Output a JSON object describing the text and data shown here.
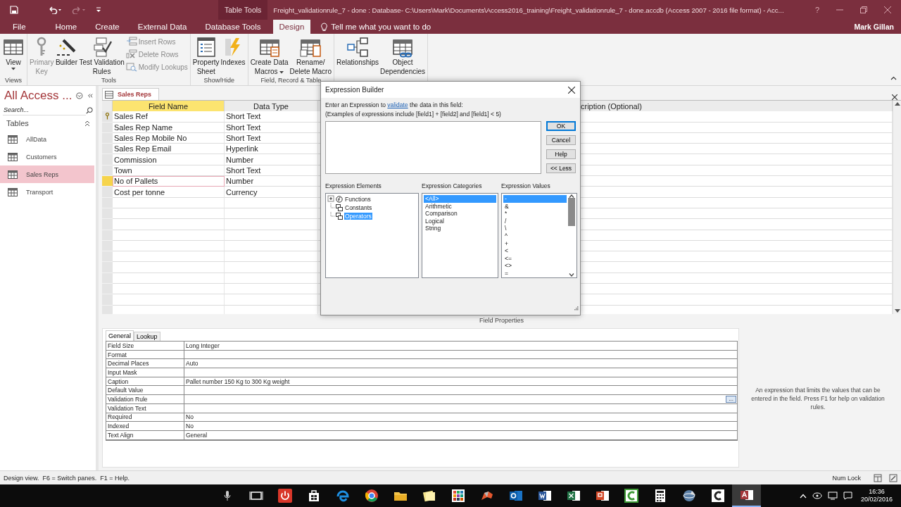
{
  "title_bar": {
    "context_label": "Table Tools",
    "title": "Freight_validationrule_7 - done : Database- C:\\Users\\Mark\\Documents\\Access2016_training\\Freight_validationrule_7 - done.accdb (Access 2007 - 2016 file format) - Acc...",
    "help": "?"
  },
  "ribbon_tabs": [
    {
      "label": "File",
      "selected": false
    },
    {
      "label": "Home",
      "selected": false
    },
    {
      "label": "Create",
      "selected": false
    },
    {
      "label": "External Data",
      "selected": false
    },
    {
      "label": "Database Tools",
      "selected": false
    },
    {
      "label": "Design",
      "selected": true
    }
  ],
  "tell_me": "Tell me what you want to do",
  "user": "Mark Gillan",
  "ribbon_groups": [
    {
      "label": "Views",
      "commands": [
        {
          "kind": "large",
          "lines": [
            "View"
          ],
          "dropdown": true,
          "disabled": false
        }
      ]
    },
    {
      "label": "Tools",
      "commands": [
        {
          "kind": "large",
          "lines": [
            "Primary",
            "Key"
          ],
          "disabled": true
        },
        {
          "kind": "large",
          "lines": [
            "Builder"
          ],
          "disabled": false
        },
        {
          "kind": "large",
          "lines": [
            "Test Validation",
            "Rules"
          ],
          "disabled": false
        },
        {
          "kind": "small",
          "lines": [
            "Insert Rows"
          ],
          "disabled": true
        },
        {
          "kind": "small",
          "lines": [
            "Delete Rows"
          ],
          "disabled": true
        },
        {
          "kind": "small",
          "lines": [
            "Modify Lookups"
          ],
          "disabled": true
        }
      ]
    },
    {
      "label": "Show/Hide",
      "commands": [
        {
          "kind": "large",
          "lines": [
            "Property",
            "Sheet"
          ],
          "disabled": false
        },
        {
          "kind": "large",
          "lines": [
            "Indexes"
          ],
          "disabled": false
        }
      ]
    },
    {
      "label": "Field, Record & Table",
      "commands": [
        {
          "kind": "large",
          "lines": [
            "Create Data",
            "Macros"
          ],
          "dropdown": true,
          "disabled": false
        },
        {
          "kind": "large",
          "lines": [
            "Rename/",
            "Delete Macro"
          ],
          "disabled": false
        }
      ]
    },
    {
      "commands": [
        {
          "kind": "large",
          "lines": [
            "Relationships"
          ],
          "disabled": false
        },
        {
          "kind": "large",
          "lines": [
            "Object",
            "Dependencies"
          ],
          "disabled": false
        }
      ]
    }
  ],
  "nav_pane": {
    "title": "All Access ...",
    "search_placeholder": "Search...",
    "section": "Tables",
    "items": [
      {
        "label": "AllData",
        "selected": false
      },
      {
        "label": "Customers",
        "selected": false
      },
      {
        "label": "Sales Reps",
        "selected": true
      },
      {
        "label": "Transport",
        "selected": false
      }
    ]
  },
  "document": {
    "tab": "Sales Reps",
    "columns": [
      {
        "label": "Field Name",
        "active": true
      },
      {
        "label": "Data Type",
        "active": false
      },
      {
        "label": "cription (Optional)",
        "active": false
      }
    ],
    "rows": [
      {
        "field_name": "Sales Ref",
        "data_type": "Short Text",
        "primary_key": true,
        "selected": false
      },
      {
        "field_name": "Sales Rep Name",
        "data_type": "Short Text",
        "primary_key": false,
        "selected": false
      },
      {
        "field_name": "Sales Rep Mobile No",
        "data_type": "Short Text",
        "primary_key": false,
        "selected": false
      },
      {
        "field_name": "Sales Rep Email",
        "data_type": "Hyperlink",
        "primary_key": false,
        "selected": false
      },
      {
        "field_name": "Commission",
        "data_type": "Number",
        "primary_key": false,
        "selected": false
      },
      {
        "field_name": "Town",
        "data_type": "Short Text",
        "primary_key": false,
        "selected": false
      },
      {
        "field_name": "No of Pallets",
        "data_type": "Number",
        "primary_key": false,
        "selected": true
      },
      {
        "field_name": "Cost per tonne",
        "data_type": "Currency",
        "primary_key": false,
        "selected": false
      }
    ]
  },
  "field_properties": {
    "label": "Field Properties",
    "tabs": [
      {
        "label": "General",
        "selected": true
      },
      {
        "label": "Lookup",
        "selected": false
      }
    ],
    "rows": [
      {
        "name": "Field Size",
        "value": "Long Integer"
      },
      {
        "name": "Format"
      },
      {
        "name": "Decimal Places",
        "value": "Auto"
      },
      {
        "name": "Input Mask"
      },
      {
        "name": "Caption",
        "value": "Pallet number 150 Kg to 300 Kg weight"
      },
      {
        "name": "Default Value"
      },
      {
        "name": "Validation Rule",
        "button": "..."
      },
      {
        "name": "Validation Text"
      },
      {
        "name": "Required",
        "value": "No"
      },
      {
        "name": "Indexed",
        "value": "No"
      },
      {
        "name": "Text Align",
        "value": "General"
      }
    ],
    "help": "An expression that limits the values that can be entered in the field. Press F1 for help on validation rules."
  },
  "dialog": {
    "title": "Expression Builder",
    "instruction_before": "Enter an Expression to ",
    "link": "validate",
    "instruction_after": " the data in this field:",
    "examples": "(Examples of expressions include [field1] + [field2] and [field1] < 5)",
    "buttons": [
      {
        "label": "OK",
        "default": true
      },
      {
        "label": "Cancel",
        "default": false
      },
      {
        "label": "Help",
        "default": false
      },
      {
        "label": "<< Less",
        "default": false
      }
    ],
    "elements_label": "Expression Elements",
    "elements": [
      {
        "label": "Functions",
        "expanded": false,
        "selected": false
      },
      {
        "label": "Constants",
        "selected": false
      },
      {
        "label": "Operators",
        "selected": true
      }
    ],
    "categories_label": "Expression Categories",
    "categories": [
      {
        "label": "<All>",
        "selected": true
      },
      {
        "label": "Arithmetic",
        "selected": false
      },
      {
        "label": "Comparison",
        "selected": false
      },
      {
        "label": "Logical",
        "selected": false
      },
      {
        "label": "String",
        "selected": false
      }
    ],
    "values_label": "Expression Values",
    "values": [
      {
        "label": "-",
        "selected": true
      },
      {
        "label": "&",
        "selected": false
      },
      {
        "label": "*",
        "selected": false
      },
      {
        "label": "/",
        "selected": false
      },
      {
        "label": "\\",
        "selected": false
      },
      {
        "label": "^",
        "selected": false
      },
      {
        "label": "+",
        "selected": false
      },
      {
        "label": "<",
        "selected": false
      },
      {
        "label": "<=",
        "selected": false
      },
      {
        "label": "<>",
        "selected": false
      },
      {
        "label": "=",
        "selected": false
      }
    ]
  },
  "status_bar": {
    "text": "Design view.  F6 = Switch panes.  F1 = Help.",
    "num_lock": "Num Lock"
  },
  "taskbar": {
    "time": "16:36",
    "date": "20/02/2016"
  }
}
